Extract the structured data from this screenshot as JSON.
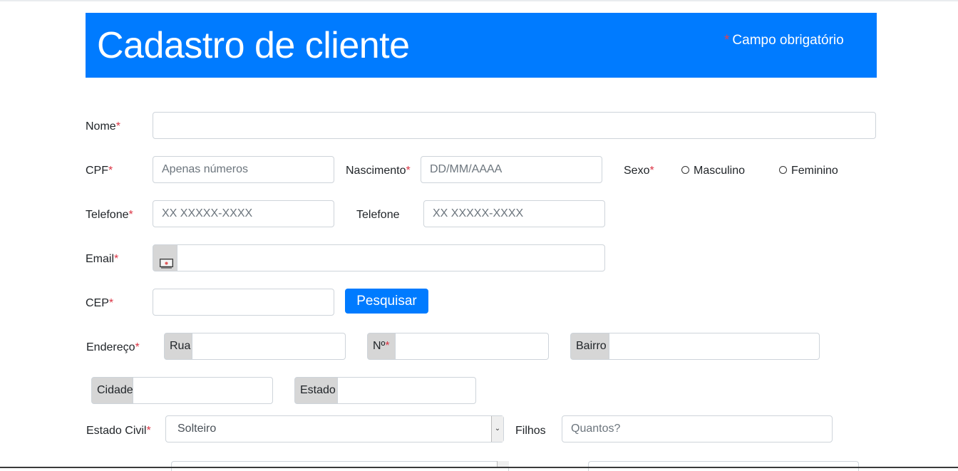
{
  "header": {
    "title": "Cadastro de cliente",
    "required_star": "*",
    "required_note": "Campo obrigatório"
  },
  "form": {
    "nome": {
      "label": "Nome",
      "star": "*",
      "value": ""
    },
    "cpf": {
      "label": "CPF",
      "star": "*",
      "placeholder": "Apenas números"
    },
    "nascimento": {
      "label": "Nascimento",
      "star": "*",
      "placeholder": "DD/MM/AAAA"
    },
    "sexo": {
      "label": "Sexo",
      "star": "*",
      "options": [
        "Masculino",
        "Feminino"
      ]
    },
    "telefone1": {
      "label": "Telefone",
      "star": "*",
      "placeholder": "XX XXXXX-XXXX"
    },
    "telefone2": {
      "label": "Telefone",
      "placeholder": "XX XXXXX-XXXX"
    },
    "email": {
      "label": "Email",
      "star": "*",
      "icon": "email-icon"
    },
    "cep": {
      "label": "CEP",
      "star": "*",
      "button": "Pesquisar"
    },
    "endereco": {
      "label": "Endereço",
      "star": "*",
      "rua": "Rua",
      "numero": "Nº",
      "numero_star": "*",
      "bairro": "Bairro",
      "cidade": "Cidade",
      "estado": "Estado"
    },
    "estado_civil": {
      "label": "Estado Civil",
      "star": "*",
      "selected": "Solteiro"
    },
    "filhos": {
      "label": "Filhos",
      "placeholder": "Quantos?"
    }
  },
  "colors": {
    "primary": "#007bff",
    "required": "#dc3545"
  }
}
